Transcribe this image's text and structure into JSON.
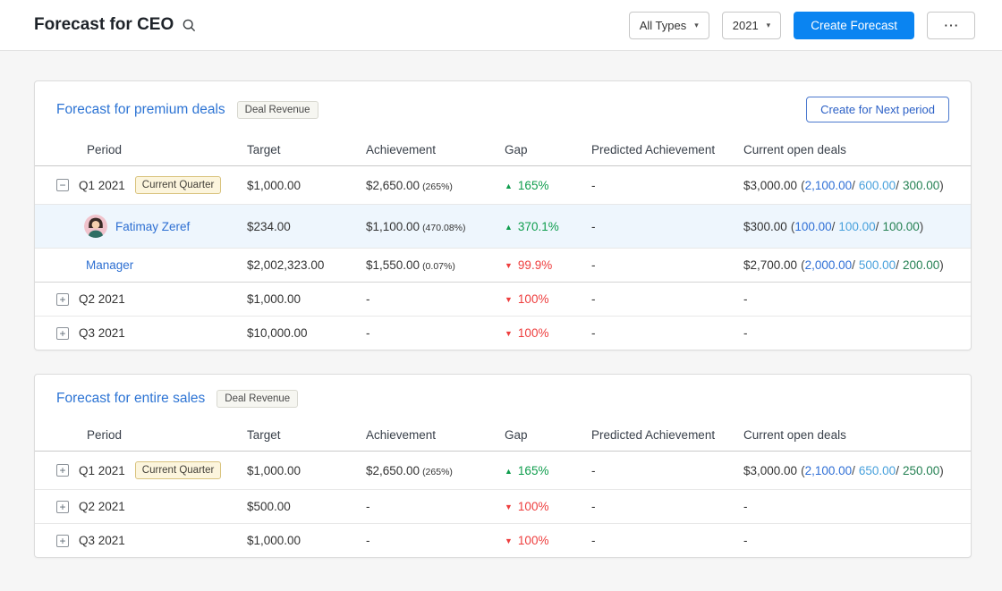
{
  "header": {
    "title": "Forecast for CEO",
    "type_filter": "All Types",
    "year_filter": "2021",
    "create_button": "Create Forecast",
    "more_button": "⋯",
    "caret": "▾"
  },
  "icons": {
    "arrow_up": "▲",
    "arrow_down": "▼",
    "expand": "+",
    "collapse": "−",
    "search": "search-icon"
  },
  "punct": {
    "open": "(",
    "slash": "/",
    "close": ")"
  },
  "columns": [
    "Period",
    "Target",
    "Achievement",
    "Gap",
    "Predicted Achievement",
    "Current open deals"
  ],
  "colors": {
    "accent_blue": "#0a84f1",
    "link_blue": "#2d6fd2",
    "gap_up_green": "#0f9d4d",
    "gap_down_red": "#ee3e3e"
  },
  "cards": [
    {
      "title": "Forecast for premium deals",
      "badge": "Deal Revenue",
      "action": "Create for Next period",
      "rows": [
        {
          "period": "Q1 2021",
          "badge": "Current Quarter",
          "target": "$1,000.00",
          "ach": "$2,650.00",
          "ach_pct": "(265%)",
          "gap": "165%",
          "pred": "-",
          "open_total": "$3,000.00",
          "open1": "2,100.00",
          "open2": "600.00",
          "open3": "300.00"
        },
        {
          "name": "Fatimay Zeref",
          "target": "$234.00",
          "ach": "$1,100.00",
          "ach_pct": "(470.08%)",
          "gap": "370.1%",
          "pred": "-",
          "open_total": "$300.00",
          "open1": "100.00",
          "open2": "100.00",
          "open3": "100.00"
        },
        {
          "name": "Manager",
          "target": "$2,002,323.00",
          "ach": "$1,550.00",
          "ach_pct": "(0.07%)",
          "gap": "99.9%",
          "pred": "-",
          "open_total": "$2,700.00",
          "open1": "2,000.00",
          "open2": "500.00",
          "open3": "200.00"
        },
        {
          "period": "Q2 2021",
          "target": "$1,000.00",
          "ach": "-",
          "gap": "100%",
          "pred": "-",
          "open": "-"
        },
        {
          "period": "Q3 2021",
          "target": "$10,000.00",
          "ach": "-",
          "gap": "100%",
          "pred": "-",
          "open": "-"
        }
      ]
    },
    {
      "title": "Forecast for entire sales",
      "badge": "Deal Revenue",
      "rows": [
        {
          "period": "Q1 2021",
          "badge": "Current Quarter",
          "target": "$1,000.00",
          "ach": "$2,650.00",
          "ach_pct": "(265%)",
          "gap": "165%",
          "pred": "-",
          "open_total": "$3,000.00",
          "open1": "2,100.00",
          "open2": "650.00",
          "open3": "250.00"
        },
        {
          "period": "Q2 2021",
          "target": "$500.00",
          "ach": "-",
          "gap": "100%",
          "pred": "-",
          "open": "-"
        },
        {
          "period": "Q3 2021",
          "target": "$1,000.00",
          "ach": "-",
          "gap": "100%",
          "pred": "-",
          "open": "-"
        }
      ]
    }
  ]
}
